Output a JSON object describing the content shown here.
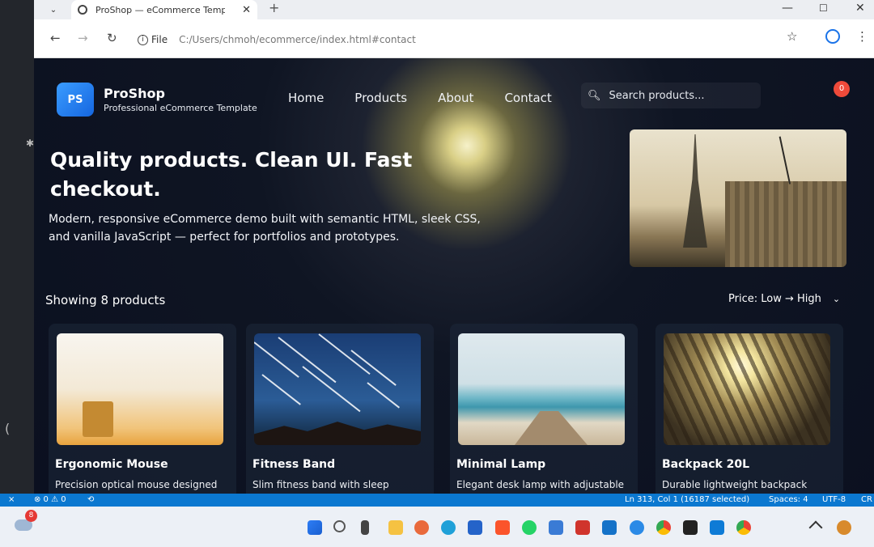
{
  "browser": {
    "tab_title": "ProShop — eCommerce Templ",
    "new_tab": "+",
    "url_label": "File",
    "url": "C:/Users/chmoh/ecommerce/index.html#contact"
  },
  "header": {
    "logo": "PS",
    "brand_name": "ProShop",
    "tagline": "Professional eCommerce Template",
    "nav": [
      "Home",
      "Products",
      "About",
      "Contact"
    ],
    "search_placeholder": "Search products...",
    "cart_count": "0"
  },
  "hero": {
    "title": "Quality products. Clean UI. Fast checkout.",
    "subtitle": "Modern, responsive eCommerce demo built with semantic HTML, sleek CSS, and vanilla JavaScript — perfect for portfolios and prototypes."
  },
  "toolbar": {
    "showing": "Showing 8 products",
    "sort": "Price: Low → High"
  },
  "products": [
    {
      "name": "Ergonomic Mouse",
      "desc": "Precision optical mouse designed"
    },
    {
      "name": "Fitness Band",
      "desc": "Slim fitness band with sleep"
    },
    {
      "name": "Minimal Lamp",
      "desc": "Elegant desk lamp with adjustable"
    },
    {
      "name": "Backpack 20L",
      "desc": "Durable lightweight backpack"
    }
  ],
  "statusbar": {
    "problems": "⊗ 0 ⚠ 0",
    "cursor": "Ln 313, Col 1 (16187 selected)",
    "spaces": "Spaces: 4",
    "encoding": "UTF-8",
    "eol": "CR"
  },
  "taskbar": {
    "notification_count": "8"
  },
  "colors": {
    "accent": "#1e7bf0",
    "badge": "#ef4a3a",
    "statusbar": "#0b78d0"
  }
}
